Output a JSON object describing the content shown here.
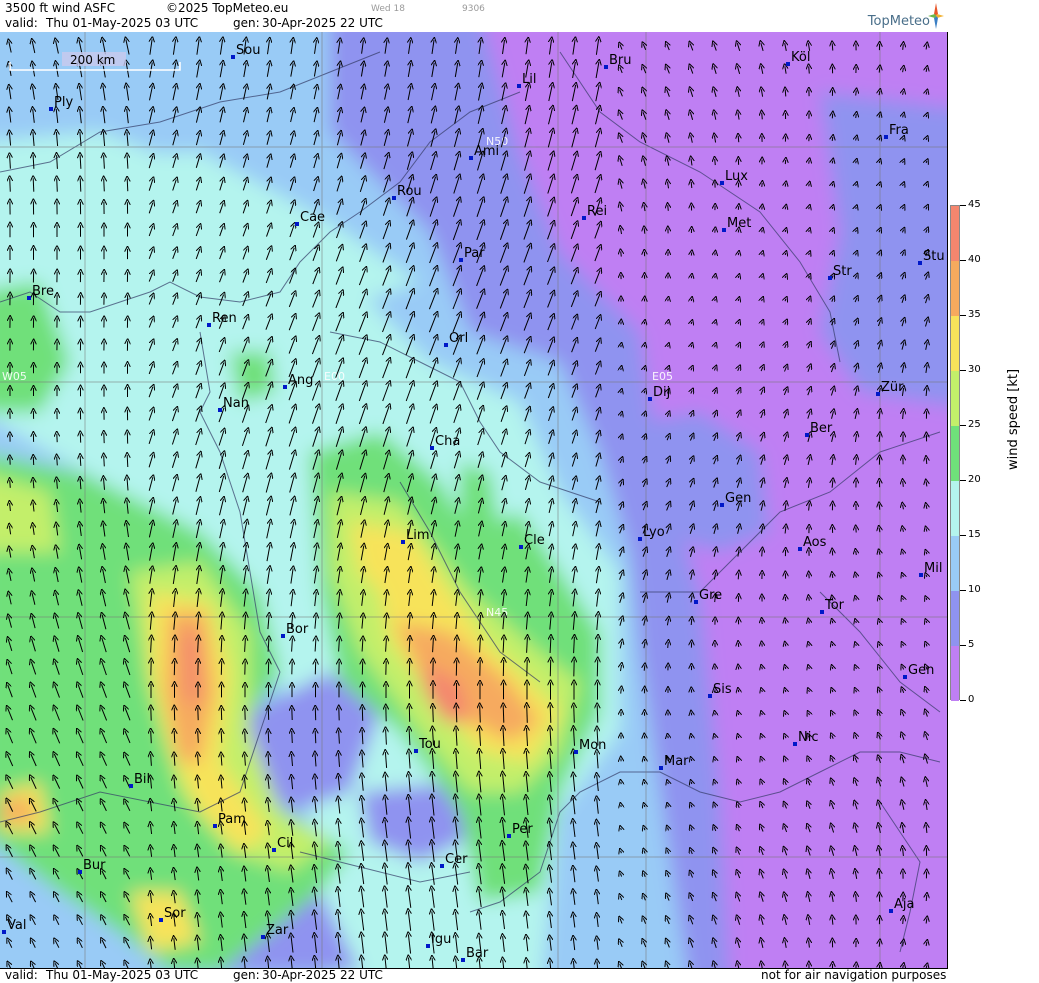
{
  "header": {
    "product": "3500 ft wind ASFC",
    "copyright": "©2025 TopMeteo.eu",
    "day_marker": "Wed 18",
    "small_code": "9306",
    "valid_label": "valid:",
    "valid_time": "Thu  01-May-2025  03 UTC",
    "gen_label": "gen:",
    "gen_time": "30-Apr-2025 22 UTC",
    "logo_text": "TopMeteo"
  },
  "footer": {
    "valid_label": "valid:",
    "valid_time": "Thu  01-May-2025  03 UTC",
    "gen_label": "gen:",
    "gen_time": "30-Apr-2025 22 UTC",
    "disclaimer": "not for air navigation purposes"
  },
  "scale_bar": {
    "label": "200 km"
  },
  "legend": {
    "title": "wind speed [kt]",
    "ticks": [
      "45",
      "40",
      "35",
      "30",
      "25",
      "20",
      "15",
      "10",
      "5",
      "0"
    ],
    "bands": [
      {
        "from": 40,
        "to": 45,
        "color": "#f4866e"
      },
      {
        "from": 35,
        "to": 40,
        "color": "#f6aa5e"
      },
      {
        "from": 30,
        "to": 35,
        "color": "#f7e35a"
      },
      {
        "from": 25,
        "to": 30,
        "color": "#c3ef6a"
      },
      {
        "from": 20,
        "to": 25,
        "color": "#6fe07a"
      },
      {
        "from": 15,
        "to": 20,
        "color": "#b4f4ee"
      },
      {
        "from": 10,
        "to": 15,
        "color": "#99cbf6"
      },
      {
        "from": 5,
        "to": 10,
        "color": "#8f93f0"
      },
      {
        "from": 0,
        "to": 5,
        "color": "#bf7ff3"
      }
    ]
  },
  "grid_labels": [
    "N50",
    "N45",
    "W05",
    "E00",
    "E05"
  ],
  "cities": [
    "Sou",
    "Ply",
    "Lil",
    "Bru",
    "Köl",
    "Ami",
    "Fra",
    "Lux",
    "Rou",
    "Cae",
    "Rei",
    "Met",
    "Par",
    "Stu",
    "Str",
    "Bre",
    "Ren",
    "Orl",
    "Ang",
    "Zür",
    "Nan",
    "Dij",
    "Ber",
    "Cha",
    "Gen",
    "Lim",
    "Cle",
    "Lyo",
    "Aos",
    "Mil",
    "Gre",
    "Tor",
    "Bor",
    "Sis",
    "Gen",
    "Nic",
    "Tou",
    "Mon",
    "Mar",
    "Bil",
    "Pam",
    "Cil",
    "Per",
    "Bur",
    "Cer",
    "Sor",
    "Aja",
    "Val",
    "Zar",
    "Igu",
    "Bar"
  ],
  "colors": {
    "purple": "#bf7ff3",
    "violet": "#8f93f0",
    "light_blue": "#99cbf6",
    "cyan": "#b4f4ee",
    "green": "#6fe07a",
    "yellow_green": "#c3ef6a",
    "yellow": "#f7e35a",
    "orange": "#f6aa5e",
    "red": "#f4866e",
    "city_marker": "#0018c8"
  }
}
